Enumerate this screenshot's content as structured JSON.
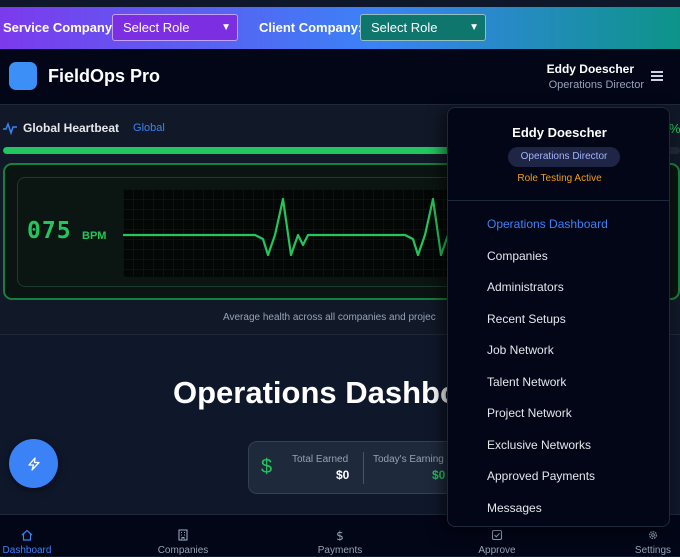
{
  "topbar": {
    "service_label": "Service Company:",
    "service_select": "Select Role",
    "client_label": "Client Company:",
    "client_select": "Select Role"
  },
  "header": {
    "app_name": "FieldOps Pro",
    "user_name": "Eddy Doescher",
    "user_role": "Operations Director"
  },
  "heartbeat": {
    "title": "Global Heartbeat",
    "scope": "Global",
    "pct_glyph": "%",
    "bpm_value": "075",
    "bpm_unit": "BPM",
    "caption": "Average health across all companies and projec",
    "health_level": 0.97
  },
  "main": {
    "title": "Operations Dashbo",
    "earnings": {
      "total_label": "Total Earned",
      "total_value": "$0",
      "today_label": "Today's Earning",
      "today_value": "$0"
    }
  },
  "menu": {
    "user_name": "Eddy Doescher",
    "user_role": "Operations Director",
    "testing": "Role Testing Active",
    "items": [
      "Operations Dashboard",
      "Companies",
      "Administrators",
      "Recent Setups",
      "Job Network",
      "Talent Network",
      "Project Network",
      "Exclusive Networks",
      "Approved Payments",
      "Messages"
    ]
  },
  "bottom_nav": {
    "items": [
      {
        "label": "Dashboard",
        "icon": "home-icon"
      },
      {
        "label": "Companies",
        "icon": "building-icon"
      },
      {
        "label": "Payments",
        "icon": "dollar-icon"
      },
      {
        "label": "Approve",
        "icon": "check-square-icon"
      },
      {
        "label": "Settings",
        "icon": "gear-icon"
      }
    ]
  },
  "colors": {
    "accent": "#3b82f6",
    "success": "#22c55e",
    "warning": "#f59e0b",
    "background": "#0f172a"
  }
}
